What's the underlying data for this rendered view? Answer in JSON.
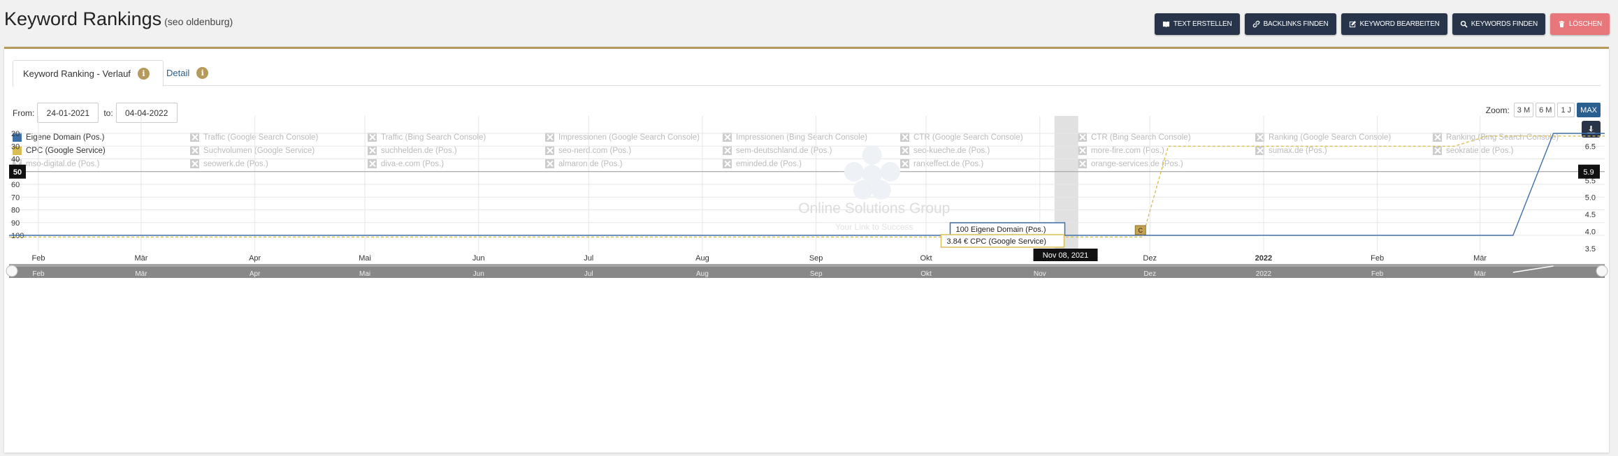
{
  "header": {
    "title": "Keyword Rankings",
    "subtitle": "(seo oldenburg)",
    "buttons": [
      {
        "label": "TEXT ERSTELLEN",
        "icon": "book-icon"
      },
      {
        "label": "BACKLINKS FINDEN",
        "icon": "link-icon"
      },
      {
        "label": "KEYWORD BEARBEITEN",
        "icon": "edit-icon"
      },
      {
        "label": "KEYWORDS FINDEN",
        "icon": "search-icon"
      },
      {
        "label": "LÖSCHEN",
        "icon": "trash-icon"
      }
    ]
  },
  "tabs": [
    {
      "label": "Keyword Ranking - Verlauf",
      "info": "i"
    },
    {
      "label": "Detail",
      "info": "i"
    }
  ],
  "range": {
    "from_label": "From:",
    "from": "24-01-2021",
    "to_label": "to:",
    "to": "04-04-2022"
  },
  "zoom": {
    "label": "Zoom:",
    "options": [
      "3 M",
      "6 M",
      "1 J",
      "MAX"
    ],
    "active": "MAX"
  },
  "legend": {
    "active": [
      {
        "label": "Eigene Domain (Pos.)",
        "color": "#3d6fa8"
      },
      {
        "label": "CPC (Google Service)",
        "color": "#d9bd55"
      }
    ],
    "inactive": [
      "Traffic (Google Search Console)",
      "Traffic (Bing Search Console)",
      "Impressionen (Google Search Console)",
      "Impressionen (Bing Search Console)",
      "CTR (Google Search Console)",
      "CTR (Bing Search Console)",
      "Ranking (Google Search Console)",
      "Ranking (Bing Search Console)",
      "Suchvolumen (Google Service)",
      "suchhelden.de (Pos.)",
      "seo-nerd.com (Pos.)",
      "sem-deutschland.de (Pos.)",
      "seo-kueche.de (Pos.)",
      "more-fire.com (Pos.)",
      "sumax.de (Pos.)",
      "seokratie.de (Pos.)",
      "mso-digital.de (Pos.)",
      "seowerk.de (Pos.)",
      "diva-e.com (Pos.)",
      "almaron.de (Pos.)",
      "eminded.de (Pos.)",
      "rankeffect.de (Pos.)",
      "orange-services.de (Pos.)"
    ]
  },
  "watermark": {
    "line1": "Online Solutions Group",
    "line2": "Your Link to Success"
  },
  "chart_data": {
    "type": "line",
    "x_ticks": [
      "Feb",
      "Mär",
      "Apr",
      "Mai",
      "Jun",
      "Jul",
      "Aug",
      "Sep",
      "Okt",
      "Nov",
      "Dez",
      "2022",
      "Feb",
      "Mär"
    ],
    "y_left_ticks": [
      20,
      30,
      40,
      50,
      60,
      70,
      80,
      90,
      100
    ],
    "y_left_range": [
      10,
      100
    ],
    "y_right_ticks": [
      7.0,
      6.5,
      6.0,
      5.5,
      5.0,
      4.5,
      4.0,
      3.5
    ],
    "y_right_range": [
      3.5,
      7.2
    ],
    "crosshair": {
      "left": "50",
      "right": "5.9",
      "date": "Nov 08, 2021"
    },
    "series": [
      {
        "name": "Eigene Domain (Pos.)",
        "color": "#3d6fa8",
        "points": [
          [
            "2021-01-24",
            100
          ],
          [
            "2022-03-10",
            100
          ],
          [
            "2022-03-21",
            20
          ],
          [
            "2022-04-04",
            20
          ]
        ]
      },
      {
        "name": "CPC (Google Service)",
        "color": "#d9bd55",
        "points": [
          [
            "2021-01-24",
            3.84
          ],
          [
            "2021-11-29",
            3.84
          ],
          [
            "2021-12-06",
            6.5
          ],
          [
            "2022-02-22",
            6.5
          ],
          [
            "2022-03-03",
            6.8
          ],
          [
            "2022-04-04",
            6.8
          ]
        ]
      }
    ],
    "tooltips": [
      {
        "value": "100",
        "label": "Eigene Domain (Pos.)",
        "color": "#3d6fa8"
      },
      {
        "value": "3.84 €",
        "label": "CPC (Google Service)",
        "color": "#d9bd55"
      }
    ],
    "flag": "C",
    "navigator_ticks": [
      "Feb",
      "Mär",
      "Apr",
      "Mai",
      "Jun",
      "Jul",
      "Aug",
      "Sep",
      "Okt",
      "Nov",
      "Dez",
      "2022",
      "Feb",
      "Mär"
    ]
  }
}
